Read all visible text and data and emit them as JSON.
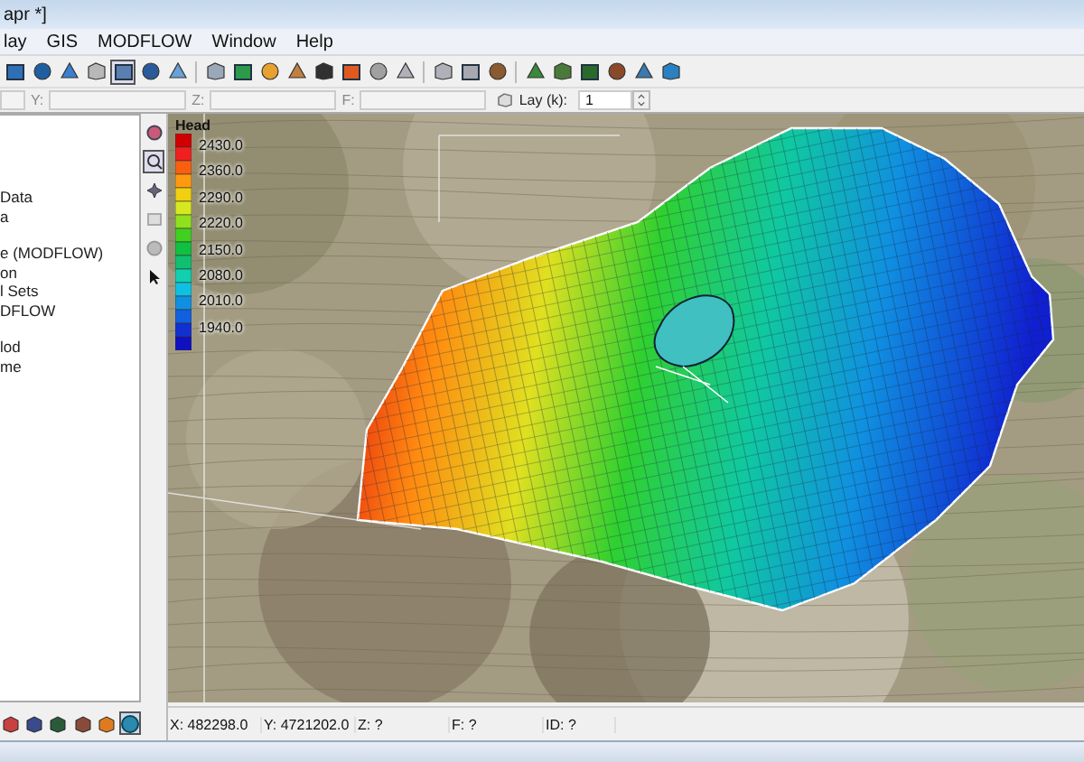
{
  "window": {
    "title": "apr *]"
  },
  "menu": [
    {
      "label": "lay"
    },
    {
      "label": "GIS"
    },
    {
      "label": "MODFLOW"
    },
    {
      "label": "Window"
    },
    {
      "label": "Help"
    }
  ],
  "toolbar": {
    "tools": [
      {
        "selected": false
      },
      {
        "selected": false
      },
      {
        "selected": false
      },
      {
        "selected": false
      },
      {
        "selected": true
      },
      {
        "selected": false
      },
      {
        "selected": false
      },
      {
        "selected": false
      },
      {
        "selected": false
      },
      {
        "selected": false
      },
      {
        "selected": false
      },
      {
        "selected": false
      },
      {
        "selected": false
      },
      {
        "selected": false
      },
      {
        "selected": false
      },
      {
        "selected": false
      },
      {
        "selected": false
      },
      {
        "selected": false
      },
      {
        "selected": false
      },
      {
        "selected": false
      },
      {
        "selected": false
      },
      {
        "selected": false
      },
      {
        "selected": false
      },
      {
        "selected": false
      }
    ]
  },
  "coord_bar": {
    "y_label": "Y:",
    "z_label": "Z:",
    "f_label": "F:",
    "layer_label": "Lay (k):",
    "layer_value": "1"
  },
  "tree": {
    "items": [
      {
        "label": "Data"
      },
      {
        "label": "a"
      },
      {
        "label": "e (MODFLOW)"
      },
      {
        "label": "on"
      },
      {
        "label": "l Sets"
      },
      {
        "label": "DFLOW"
      },
      {
        "label": "lod"
      },
      {
        "label": "me"
      }
    ]
  },
  "side_tools": [
    {
      "selected": false
    },
    {
      "selected": true
    },
    {
      "selected": false
    },
    {
      "selected": false
    },
    {
      "selected": false
    },
    {
      "selected": false
    }
  ],
  "bottom_tools": [
    {
      "selected": false
    },
    {
      "selected": false
    },
    {
      "selected": false
    },
    {
      "selected": false
    },
    {
      "selected": false
    },
    {
      "selected": true
    }
  ],
  "legend": {
    "title": "Head",
    "labels": [
      "2430.0",
      "2360.0",
      "2290.0",
      "2220.0",
      "2150.0",
      "2080.0",
      "2010.0",
      "1940.0"
    ]
  },
  "status_bar": [
    {
      "text": "X: 482298.0"
    },
    {
      "text": "Y: 4721202.0"
    },
    {
      "text": "Z: ?"
    },
    {
      "text": "F: ?"
    },
    {
      "text": "ID: ?"
    }
  ]
}
